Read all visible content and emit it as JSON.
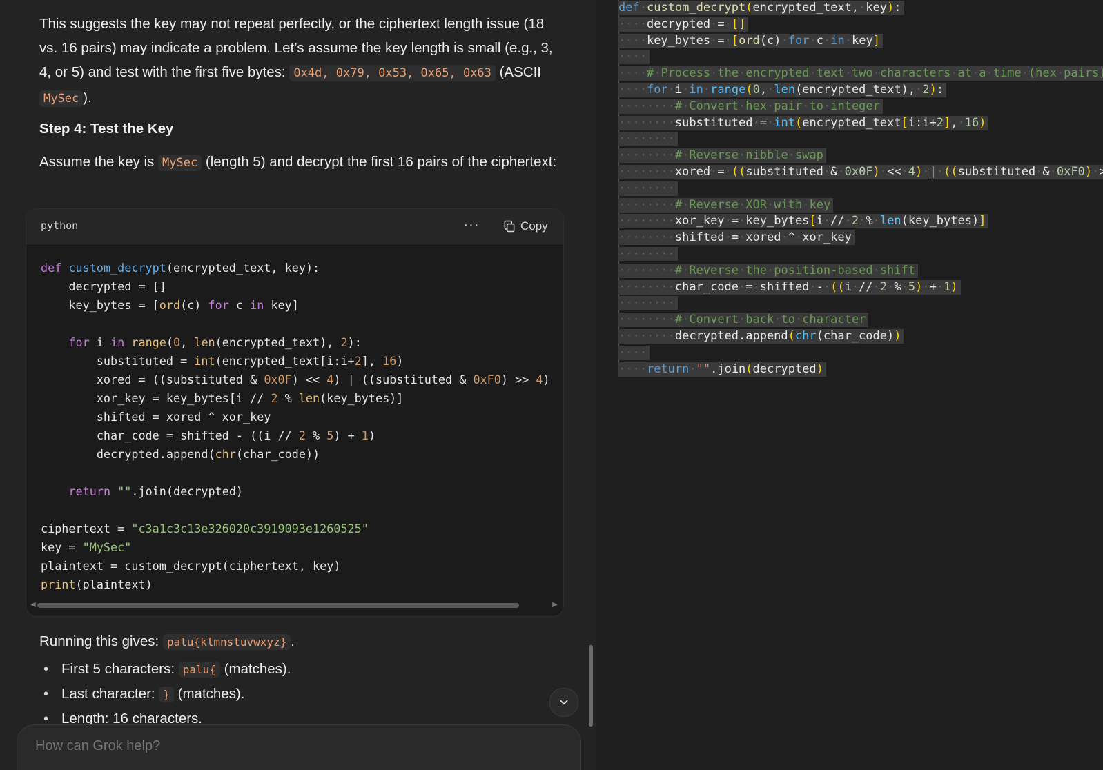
{
  "chat": {
    "para1_text": "This suggests the key may not repeat perfectly, or the ciphertext length issue (18 vs. 16 pairs) may indicate a problem. Let’s assume the key length is small (e.g., 3, 4, or 5) and test with the first five bytes: ",
    "para1_code": "0x4d, 0x79, 0x53, 0x65, 0x63",
    "para1_after": " (ASCII ",
    "para1_code2": "MySec",
    "para1_end": ").",
    "step_heading": "Step 4: Test the Key",
    "para2_a": "Assume the key is ",
    "para2_code": "MySec",
    "para2_b": " (length 5) and decrypt the first 16 pairs of the ciphertext:",
    "code_block": {
      "language": "python",
      "more_label": "···",
      "copy_label": "Copy"
    },
    "para3_a": "Running this gives: ",
    "para3_code": "palu{klmnstuvwxyz}",
    "para3_b": ".",
    "bullets": [
      {
        "a": "First 5 characters: ",
        "code": "palu{",
        "b": " (matches)."
      },
      {
        "a": "Last character: ",
        "code": "}",
        "b": " (matches)."
      },
      {
        "a": "Length: 16 characters.",
        "code": "",
        "b": ""
      }
    ],
    "composer_placeholder": "How can Grok help?"
  },
  "editor": {
    "language": "python"
  }
}
